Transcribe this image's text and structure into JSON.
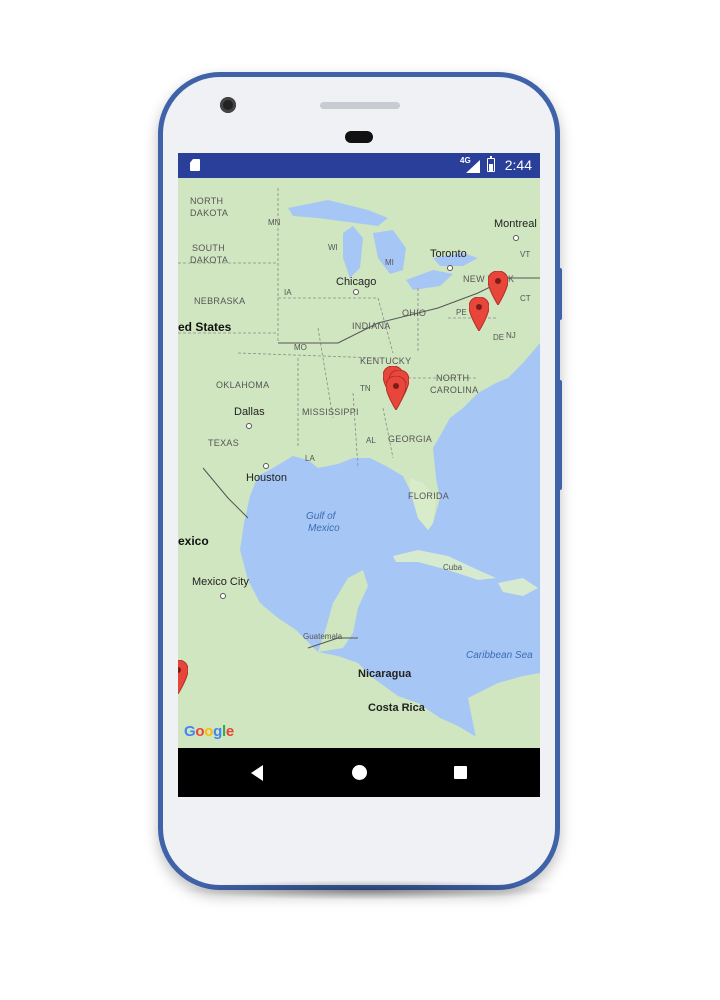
{
  "status_bar": {
    "time": "2:44",
    "network": "4G",
    "icons": [
      "sd-card-icon",
      "signal-icon",
      "battery-icon"
    ]
  },
  "map": {
    "provider_logo": "Google",
    "labels": {
      "north_dakota_1": "NORTH",
      "north_dakota_2": "DAKOTA",
      "south_dakota_1": "SOUTH",
      "south_dakota_2": "DAKOTA",
      "nebraska": "NEBRASKA",
      "united_states": "ed States",
      "oklahoma": "OKLAHOMA",
      "texas": "TEXAS",
      "dallas": "Dallas",
      "houston": "Houston",
      "mississippi": "MISSISSIPPI",
      "ia": "IA",
      "mo": "MO",
      "wi": "WI",
      "mi": "MI",
      "mn": "MN",
      "chicago": "Chicago",
      "indiana": "INDIANA",
      "ohio": "OHIO",
      "kentucky": "KENTUCKY",
      "tn": "TN",
      "georgia": "GEORGIA",
      "north_carolina_1": "NORTH",
      "north_carolina_2": "CAROLINA",
      "florida": "FLORIDA",
      "la": "LA",
      "al": "AL",
      "toronto": "Toronto",
      "montreal": "Montreal",
      "vt": "VT",
      "new_york": "NEW YORK",
      "ct": "CT",
      "pe": "PE",
      "de": "DE",
      "nj": "NJ",
      "gulf_1": "Gulf of",
      "gulf_2": "Mexico",
      "mexico": "exico",
      "mexico_city": "Mexico City",
      "cuba": "Cuba",
      "guatemala": "Guatemala",
      "caribbean_sea": "Caribbean Sea",
      "nicaragua": "Nicaragua",
      "costa_rica": "Costa Rica"
    },
    "marker_color": "#e8463a",
    "markers": [
      {
        "name": "marker-new-york"
      },
      {
        "name": "marker-pennsylvania"
      },
      {
        "name": "marker-tennessee-1"
      },
      {
        "name": "marker-tennessee-2"
      },
      {
        "name": "marker-tennessee-3"
      },
      {
        "name": "marker-mexico-pacific"
      }
    ]
  },
  "nav_bar": {
    "icons": [
      "back-icon",
      "home-icon",
      "recent-apps-icon"
    ]
  },
  "colors": {
    "device_frame": "#3f62a8",
    "status_bar": "#2a3f9a",
    "water": "#a6c7f5",
    "land": "#cfe6c0"
  }
}
